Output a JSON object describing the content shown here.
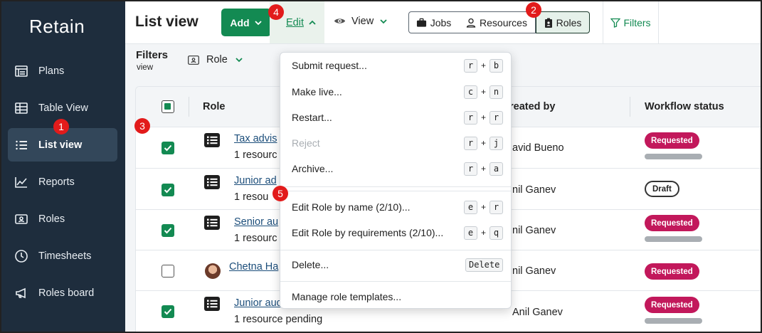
{
  "app": {
    "logo": "Retain"
  },
  "sidebar": {
    "items": [
      {
        "label": "Plans",
        "icon": "plans-icon"
      },
      {
        "label": "Table View",
        "icon": "table-icon"
      },
      {
        "label": "List view",
        "icon": "list-icon",
        "active": true
      },
      {
        "label": "Reports",
        "icon": "chart-line-icon"
      },
      {
        "label": "Roles",
        "icon": "id-card-icon"
      },
      {
        "label": "Timesheets",
        "icon": "clock-icon"
      },
      {
        "label": "Roles board",
        "icon": "megaphone-icon"
      }
    ]
  },
  "header": {
    "title": "List view",
    "add_label": "Add",
    "edit_label": "Edit",
    "view_label": "View",
    "segments": {
      "jobs": "Jobs",
      "resources": "Resources",
      "roles": "Roles"
    },
    "filters_label": "Filters"
  },
  "filters_bar": {
    "title": "Filters",
    "subtitle": "view",
    "role_filter": "Role"
  },
  "table": {
    "columns": {
      "role": "Role",
      "created_by": "reated by",
      "workflow_status": "Workflow status"
    },
    "rows": [
      {
        "checked": true,
        "role": "Tax advis",
        "sub": "1 resourc",
        "created_by": "avid Bueno",
        "status": "Requested",
        "status_type": "requested",
        "progress": 0
      },
      {
        "checked": true,
        "role": "Junior ad",
        "sub": "1 resou",
        "created_by": "nil Ganev",
        "status": "Draft",
        "status_type": "draft"
      },
      {
        "checked": true,
        "role": "Senior au",
        "sub": "1 resourc",
        "created_by": "nil Ganev",
        "status": "Requested",
        "status_type": "requested",
        "progress": 0
      },
      {
        "checked": false,
        "role": "Chetna Ha",
        "sub": "",
        "created_by": "nil Ganev",
        "status": "Requested",
        "status_type": "requested",
        "avatar": true
      },
      {
        "checked": true,
        "role": "Junior aud",
        "sub": "1 resource pending",
        "created_by": "Anil Ganev",
        "status": "Requested",
        "status_type": "requested",
        "progress": 0
      }
    ]
  },
  "edit_menu": {
    "items": [
      {
        "label": "Submit request...",
        "keys": [
          "r",
          "b"
        ]
      },
      {
        "label": "Make live...",
        "keys": [
          "c",
          "n"
        ]
      },
      {
        "label": "Restart...",
        "keys": [
          "r",
          "r"
        ]
      },
      {
        "label": "Reject",
        "keys": [
          "r",
          "j"
        ],
        "disabled": true
      },
      {
        "label": "Archive...",
        "keys": [
          "r",
          "a"
        ]
      },
      {
        "label": "Edit Role by name (2/10)...",
        "keys": [
          "e",
          "r"
        ]
      },
      {
        "label": "Edit Role by requirements (2/10)...",
        "keys": [
          "e",
          "q"
        ]
      },
      {
        "label": "Delete...",
        "keys": [
          "Delete"
        ]
      },
      {
        "label": "Manage role templates..."
      }
    ],
    "plus": "+"
  },
  "annotations": [
    "1",
    "2",
    "3",
    "4",
    "5"
  ],
  "colors": {
    "sidebar_bg": "#1e2d3d",
    "brand_green": "#138a52",
    "requested_badge": "#c2185b",
    "marker_red": "#e21b1b"
  }
}
